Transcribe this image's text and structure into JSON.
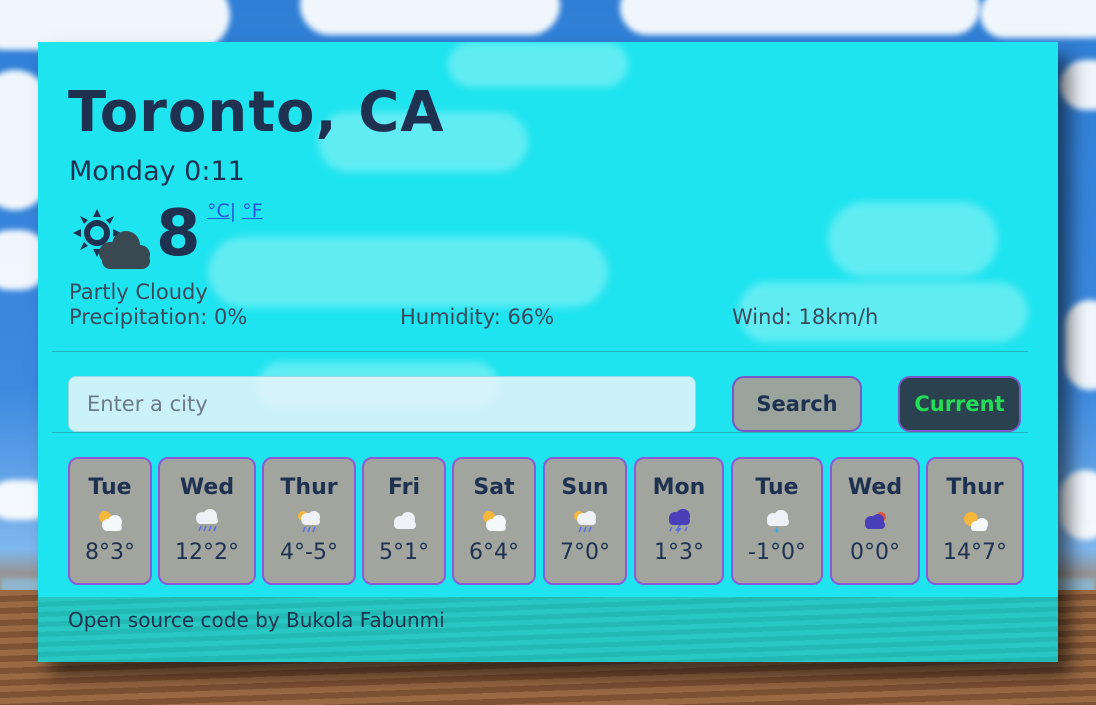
{
  "location": {
    "city": "Toronto, CA",
    "datetime": "Monday 0:11"
  },
  "current": {
    "temperature": "8",
    "icon": "partly-cloudy-icon",
    "unit_celsius": "°C",
    "unit_separator": "|",
    "unit_fahrenheit": "°F",
    "description": "Partly Cloudy",
    "precipitation": "Precipitation: 0%",
    "humidity": "Humidity: 66%",
    "wind": "Wind: 18km/h"
  },
  "search": {
    "placeholder": "Enter a city",
    "value": "",
    "search_label": "Search",
    "current_label": "Current"
  },
  "forecast": [
    {
      "day": "Tue",
      "temps": "8°3°",
      "icon": "sun-cloud-icon"
    },
    {
      "day": "Wed",
      "temps": "12°2°",
      "icon": "rain-icon"
    },
    {
      "day": "Thur",
      "temps": "4°-5°",
      "icon": "sun-rain-icon"
    },
    {
      "day": "Fri",
      "temps": "5°1°",
      "icon": "cloud-icon"
    },
    {
      "day": "Sat",
      "temps": "6°4°",
      "icon": "sun-cloud-icon"
    },
    {
      "day": "Sun",
      "temps": "7°0°",
      "icon": "sun-rain-icon"
    },
    {
      "day": "Mon",
      "temps": "1°3°",
      "icon": "thunderstorm-icon"
    },
    {
      "day": "Tue",
      "temps": "-1°0°",
      "icon": "cloud-drizzle-icon"
    },
    {
      "day": "Wed",
      "temps": "0°0°",
      "icon": "dark-cloud-icon"
    },
    {
      "day": "Thur",
      "temps": "14°7°",
      "icon": "sun-cloud-icon"
    }
  ],
  "footer": "Open source code by Bukola Fabunmi",
  "colors": {
    "card": "#1ee4ef",
    "text": "#1f3150",
    "tile": "#a1a59e",
    "tile_border": "#8a5ad8",
    "current_button_text": "#22dd55"
  }
}
